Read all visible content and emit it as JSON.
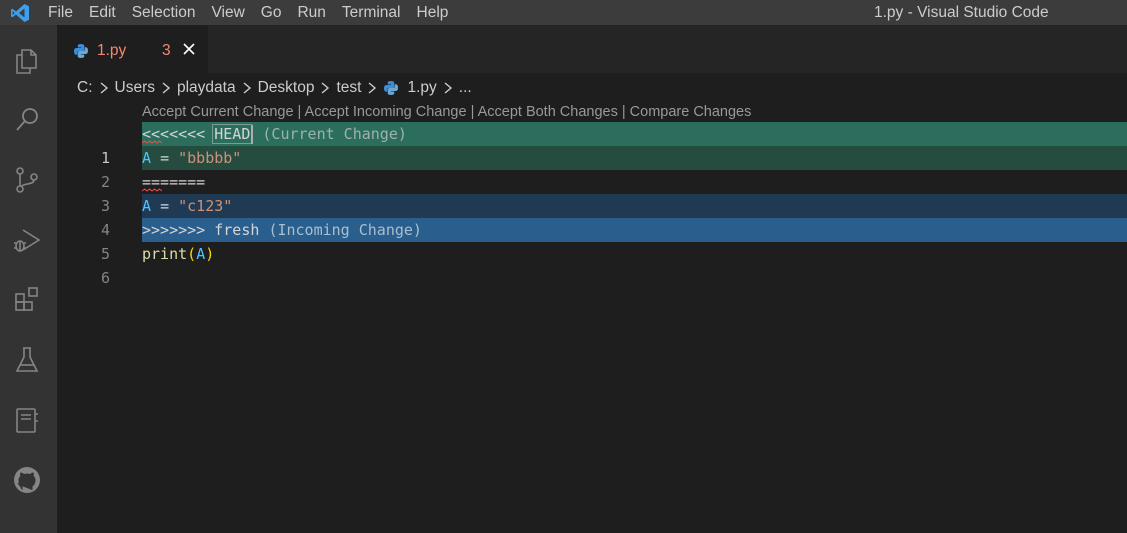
{
  "titlebar": {
    "menu": [
      "File",
      "Edit",
      "Selection",
      "View",
      "Go",
      "Run",
      "Terminal",
      "Help"
    ],
    "title": "1.py - Visual Studio Code"
  },
  "activitybar": {
    "icons": [
      "explorer-icon",
      "search-icon",
      "source-control-icon",
      "run-debug-icon",
      "extensions-icon",
      "testing-icon",
      "notebook-icon",
      "github-icon"
    ]
  },
  "tab": {
    "label": "1.py",
    "problems": "3"
  },
  "breadcrumb": {
    "items": [
      "C:",
      "Users",
      "playdata",
      "Desktop",
      "test",
      "1.py",
      "..."
    ]
  },
  "codelens": {
    "text": "Accept Current Change | Accept Incoming Change | Accept Both Changes | Compare Changes"
  },
  "editor": {
    "lines": [
      {
        "number": "1",
        "marker": "<<<<<<<",
        "label": "HEAD",
        "comment": "(Current Change)"
      },
      {
        "number": "2",
        "var": "A",
        "op": "=",
        "str": "\"bbbbb\""
      },
      {
        "number": "3",
        "marker": "======="
      },
      {
        "number": "4",
        "var": "A",
        "op": "=",
        "str": "\"c123\""
      },
      {
        "number": "5",
        "marker": ">>>>>>>",
        "label": "fresh",
        "comment": "(Incoming Change)"
      },
      {
        "number": "6",
        "fn": "print",
        "open": "(",
        "var": "A",
        "close": ")"
      }
    ]
  },
  "colors": {
    "current_header_bg": "#2c6e5d",
    "current_bg": "#254c3f",
    "incoming_bg": "#1f3a52",
    "incoming_header_bg": "#2a5f8d",
    "error": "#f48771"
  }
}
